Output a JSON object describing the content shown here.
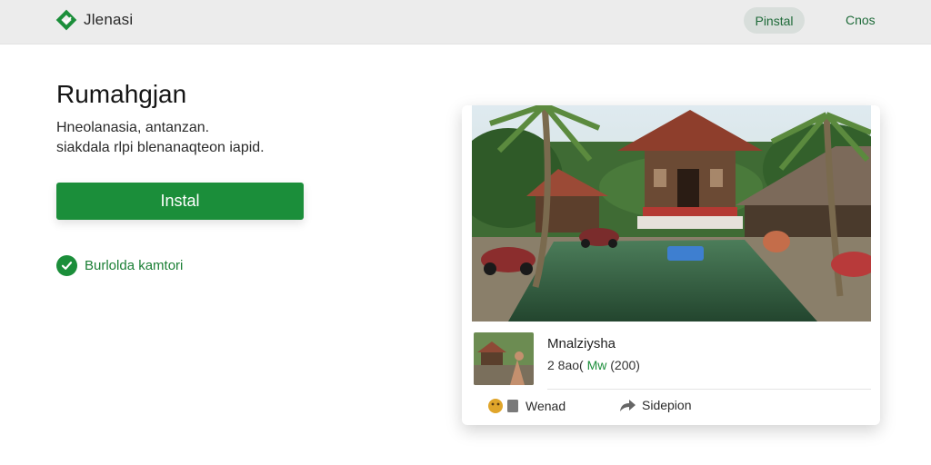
{
  "header": {
    "brand": "Jlenasi",
    "nav_primary": "Pinstal",
    "nav_secondary": "Cnos"
  },
  "hero": {
    "title": "Rumahgjan",
    "subtitle_lines": [
      "Hneolanasia, antanzan.",
      "siakdala rlpi blenanaqteon iapid."
    ],
    "install_label": "Instal",
    "check_label": "Burlolda kamtori"
  },
  "card": {
    "listing_title": "Mnalziysha",
    "meta_prefix": "2  8ao(",
    "meta_green": "Mw",
    "meta_suffix": "(200)",
    "action_save": "Wenad",
    "action_share": "Sidepion"
  },
  "colors": {
    "accent": "#1b8e3a",
    "topbar": "#ececec"
  },
  "icons": {
    "brand": "diamond-logo-icon",
    "check": "check-circle-icon",
    "save": "bookmark-icon",
    "share": "share-arrow-icon"
  }
}
